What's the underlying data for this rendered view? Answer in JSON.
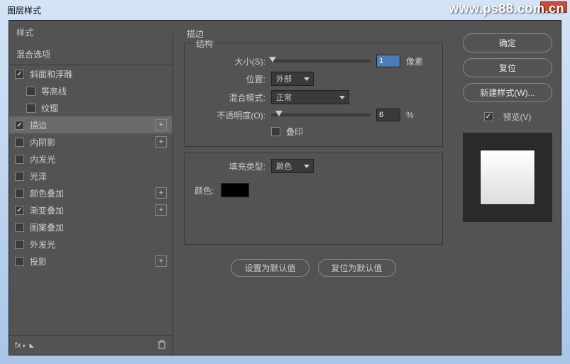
{
  "watermark": "www.ps88.com.cn",
  "title": "图层样式",
  "left": {
    "styles_header": "样式",
    "blend_options": "混合选项",
    "items": [
      {
        "label": "斜面和浮雕",
        "checked": true,
        "fx": false,
        "indent": false
      },
      {
        "label": "等高线",
        "checked": false,
        "fx": false,
        "indent": true
      },
      {
        "label": "纹理",
        "checked": false,
        "fx": false,
        "indent": true
      },
      {
        "label": "描边",
        "checked": true,
        "fx": true,
        "indent": false,
        "selected": true
      },
      {
        "label": "内阴影",
        "checked": false,
        "fx": true,
        "indent": false
      },
      {
        "label": "内发光",
        "checked": false,
        "fx": false,
        "indent": false
      },
      {
        "label": "光泽",
        "checked": false,
        "fx": false,
        "indent": false
      },
      {
        "label": "颜色叠加",
        "checked": false,
        "fx": true,
        "indent": false
      },
      {
        "label": "渐变叠加",
        "checked": true,
        "fx": true,
        "indent": false
      },
      {
        "label": "图案叠加",
        "checked": false,
        "fx": false,
        "indent": false
      },
      {
        "label": "外发光",
        "checked": false,
        "fx": false,
        "indent": false
      },
      {
        "label": "投影",
        "checked": false,
        "fx": true,
        "indent": false
      }
    ],
    "fx_label": "fx"
  },
  "center": {
    "section": "描边",
    "structure": "结构",
    "size_label": "大小(S):",
    "size_value": "1",
    "size_unit": "像素",
    "position_label": "位置:",
    "position_value": "外部",
    "blend_label": "混合模式:",
    "blend_value": "正常",
    "opacity_label": "不透明度(O):",
    "opacity_value": "6",
    "opacity_unit": "%",
    "overprint": "叠印",
    "fill_type_label": "填充类型:",
    "fill_type_value": "颜色",
    "color_label": "颜色:",
    "color_value": "#000000",
    "default_btn": "设置为默认值",
    "reset_btn": "复位为默认值"
  },
  "right": {
    "ok": "确定",
    "cancel": "复位",
    "new_style": "新建样式(W)...",
    "preview": "预览(V)"
  }
}
